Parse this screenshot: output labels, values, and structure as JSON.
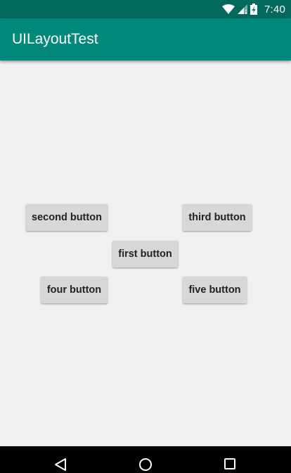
{
  "status_bar": {
    "time": "7:40",
    "icons": [
      "wifi-icon",
      "signal-icon",
      "battery-charging-icon"
    ]
  },
  "app_bar": {
    "title": "UILayoutTest"
  },
  "buttons": {
    "first": "first button",
    "second": "second button",
    "third": "third button",
    "four": "four button",
    "five": "five button"
  },
  "nav_bar": {
    "icons": [
      "back-icon",
      "home-icon",
      "recents-icon"
    ]
  },
  "colors": {
    "status_bar": "#00695c",
    "app_bar": "#00897b",
    "background": "#f0f0f0",
    "button": "#d6d7d7"
  }
}
